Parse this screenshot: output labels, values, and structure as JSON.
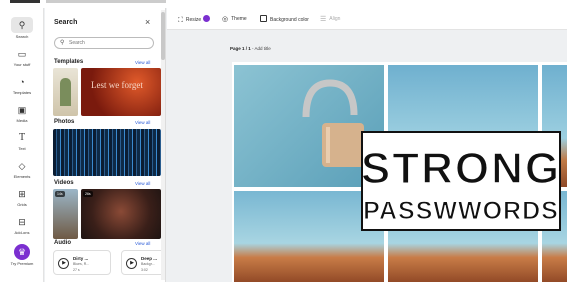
{
  "rail": {
    "items": [
      {
        "label": "Search",
        "icon": "search-icon"
      },
      {
        "label": "Your stuff",
        "icon": "folder-icon"
      },
      {
        "label": "Templates",
        "icon": "templates-icon"
      },
      {
        "label": "Media",
        "icon": "media-icon"
      },
      {
        "label": "Text",
        "icon": "text-icon"
      },
      {
        "label": "Elements",
        "icon": "elements-icon"
      },
      {
        "label": "Grids",
        "icon": "grid-icon"
      },
      {
        "label": "Add-ons",
        "icon": "addons-icon"
      },
      {
        "label": "Try Premium",
        "icon": "crown-icon"
      }
    ]
  },
  "panel": {
    "title": "Search",
    "close": "×",
    "search_placeholder": "Search",
    "templates": {
      "title": "Templates",
      "view_all": "View all",
      "promo_text": "Lest we forget"
    },
    "photos": {
      "title": "Photos",
      "view_all": "View all"
    },
    "videos": {
      "title": "Videos",
      "view_all": "View all",
      "durations": [
        "14s",
        "26s"
      ]
    },
    "audio": {
      "title": "Audio",
      "view_all": "View all",
      "tracks": [
        {
          "title": "Dirty ...",
          "artist": "Blues, R...",
          "duration": "27 s"
        },
        {
          "title": "Deep ...",
          "artist": "Backgr...",
          "duration": "3:02"
        }
      ]
    }
  },
  "toolbar": {
    "resize": "Resize",
    "theme": "Theme",
    "background_color": "Background color",
    "align": "Align"
  },
  "canvas": {
    "page_label": "Page 1 / 1",
    "add_title": " - Add title",
    "headline_line1": "STRONG",
    "headline_line2": "PASSWWORDS"
  },
  "colors": {
    "accent_purple": "#7b2fd0",
    "link_blue": "#2a5bd7",
    "sky": "#7fb7c9",
    "sand": "#b8643a"
  }
}
